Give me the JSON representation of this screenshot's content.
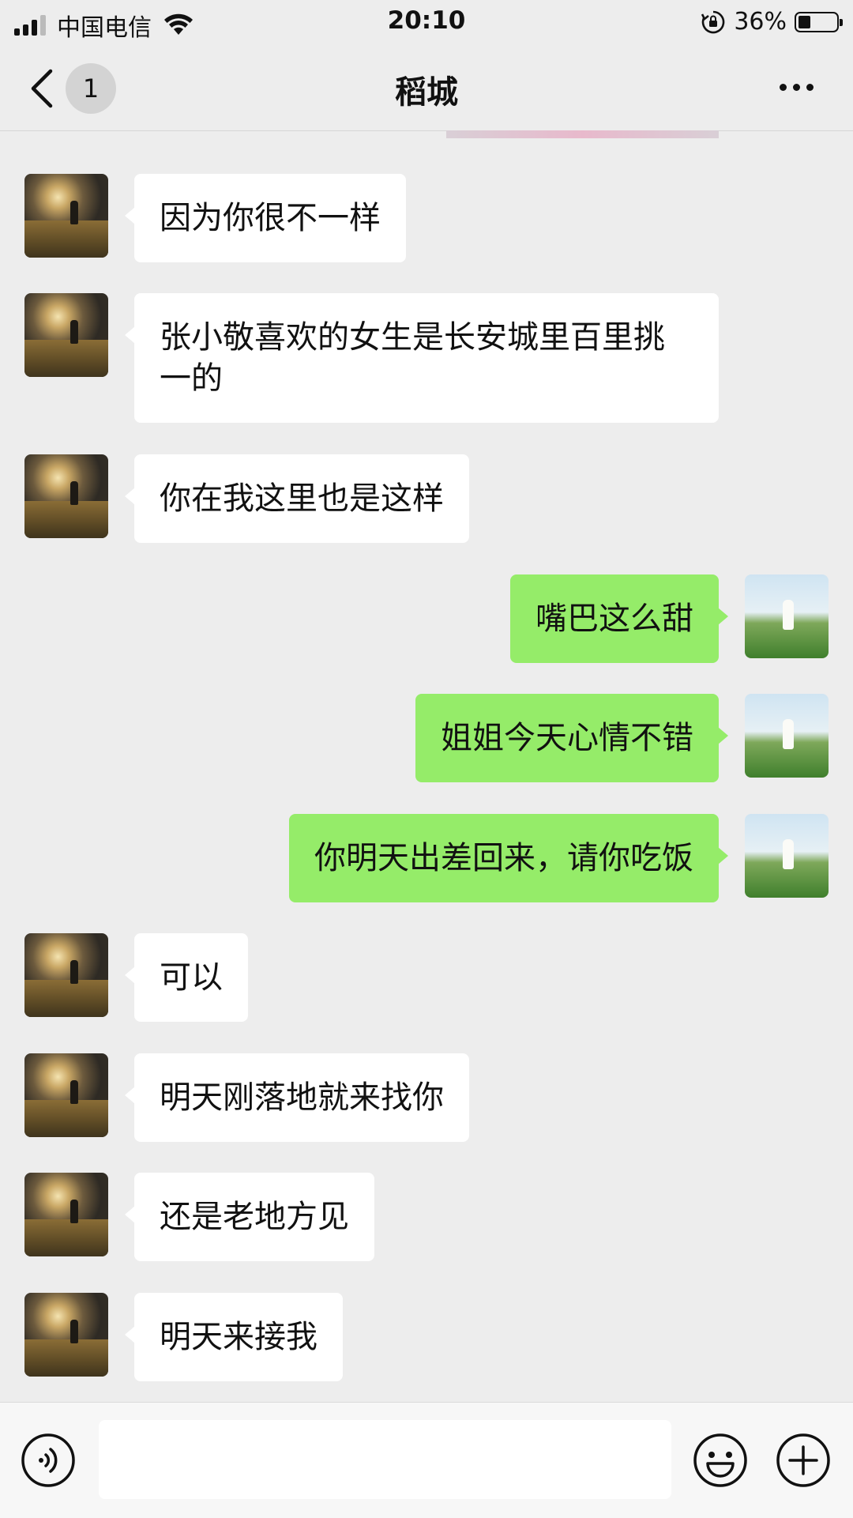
{
  "status_bar": {
    "carrier": "中国电信",
    "time": "20:10",
    "battery_percent": "36%",
    "battery_level": 0.36,
    "icons": [
      "signal-icon",
      "wifi-icon",
      "rotation-lock-icon",
      "battery-icon"
    ]
  },
  "header": {
    "unread_count": "1",
    "title": "稻城",
    "icons": [
      "back-arrow-icon",
      "more-icon"
    ]
  },
  "messages": [
    {
      "sender": "them",
      "text": "因为你很不一样"
    },
    {
      "sender": "them",
      "text": "张小敬喜欢的女生是长安城里百里挑一的"
    },
    {
      "sender": "them",
      "text": "你在我这里也是这样"
    },
    {
      "sender": "me",
      "text": "嘴巴这么甜"
    },
    {
      "sender": "me",
      "text": "姐姐今天心情不错"
    },
    {
      "sender": "me",
      "text": "你明天出差回来，请你吃饭"
    },
    {
      "sender": "them",
      "text": "可以"
    },
    {
      "sender": "them",
      "text": "明天刚落地就来找你"
    },
    {
      "sender": "them",
      "text": "还是老地方见"
    },
    {
      "sender": "them",
      "text": "明天来接我"
    }
  ],
  "input_bar": {
    "value": "",
    "icons": [
      "voice-icon",
      "emoji-icon",
      "plus-icon"
    ]
  },
  "colors": {
    "background": "#ededed",
    "my_bubble": "#95ec69",
    "their_bubble": "#ffffff"
  }
}
